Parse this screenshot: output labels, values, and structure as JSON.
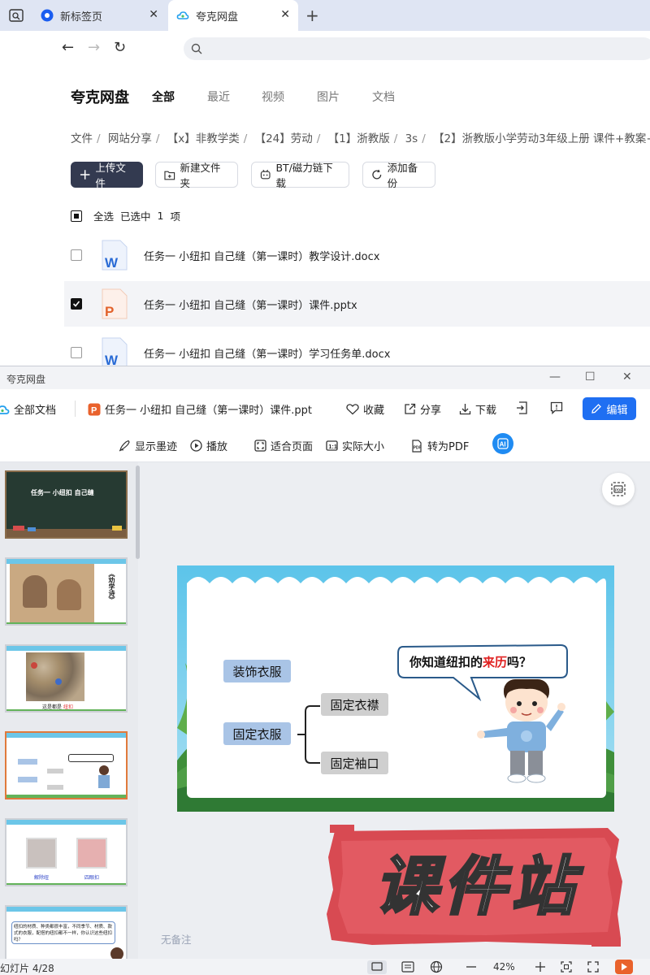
{
  "browser": {
    "tabs": [
      {
        "label": "新标签页",
        "active": false
      },
      {
        "label": "夸克网盘",
        "active": true
      }
    ]
  },
  "quark": {
    "brand": "夸克网盘",
    "nav": [
      "全部",
      "最近",
      "视频",
      "图片",
      "文档"
    ],
    "breadcrumb": [
      "文件",
      "网站分享",
      "【x】非教学类",
      "【24】劳动",
      "【1】浙教版",
      "3s",
      "【2】浙教版小学劳动3年级上册 课件+教案+"
    ],
    "actions": {
      "upload": "上传文件",
      "new_folder": "新建文件夹",
      "bt": "BT/磁力链下载",
      "backup": "添加备份"
    },
    "selection": {
      "select_all": "全选",
      "selected": "已选中",
      "count": "1",
      "unit": "项"
    },
    "files": [
      {
        "name": "任务一 小纽扣 自己缝（第一课时）教学设计.docx",
        "type": "docx",
        "selected": false
      },
      {
        "name": "任务一 小纽扣 自己缝（第一课时）课件.pptx",
        "type": "pptx",
        "selected": true
      },
      {
        "name": "任务一 小纽扣 自己缝（第一课时）学习任务单.docx",
        "type": "docx",
        "selected": false
      }
    ]
  },
  "viewer": {
    "window_title": "夸克网盘",
    "all_docs": "全部文档",
    "doc_title": "任务一 小纽扣 自己缝（第一课时）课件.ppt",
    "favorite": "收藏",
    "share": "分享",
    "download": "下载",
    "edit": "编辑",
    "tools": {
      "ink": "显示墨迹",
      "play": "播放",
      "fit_page": "适合页面",
      "actual_size": "实际大小",
      "to_pdf": "转为PDF"
    },
    "thumb1_title": "任务一 小纽扣 自己缝",
    "thumb2_caption": "《劝学诗》",
    "thumb3_caption_a": "这是都是",
    "thumb3_caption_b": "纽扣",
    "thumb5_caption_a": "解除纽",
    "thumb5_caption_b": "四眼扣",
    "thumb6_text": "纽扣的材质、种类都很丰富，不同季节、材质、款式的衣服，配搭的纽扣都不一样，你认识这些纽扣吗？",
    "no_notes": "无备注",
    "status": "幻灯片 4/28",
    "zoom": "42%"
  },
  "slide": {
    "bubble_a": "你知道纽扣的",
    "bubble_red": "来历",
    "bubble_b": "吗？",
    "box_decor": "装饰衣服",
    "box_fix": "固定衣服",
    "box_lapel": "固定衣襟",
    "box_cuff": "固定袖口"
  },
  "watermark": "课件站",
  "colors": {
    "primary_button": "#333a50",
    "edit_button": "#1f6ff2",
    "slide_box_blue": "#a9c4e6",
    "slide_box_gray": "#cfcfcf",
    "stamp_red": "#d84a52",
    "active_thumb_border": "#e07a3c"
  }
}
